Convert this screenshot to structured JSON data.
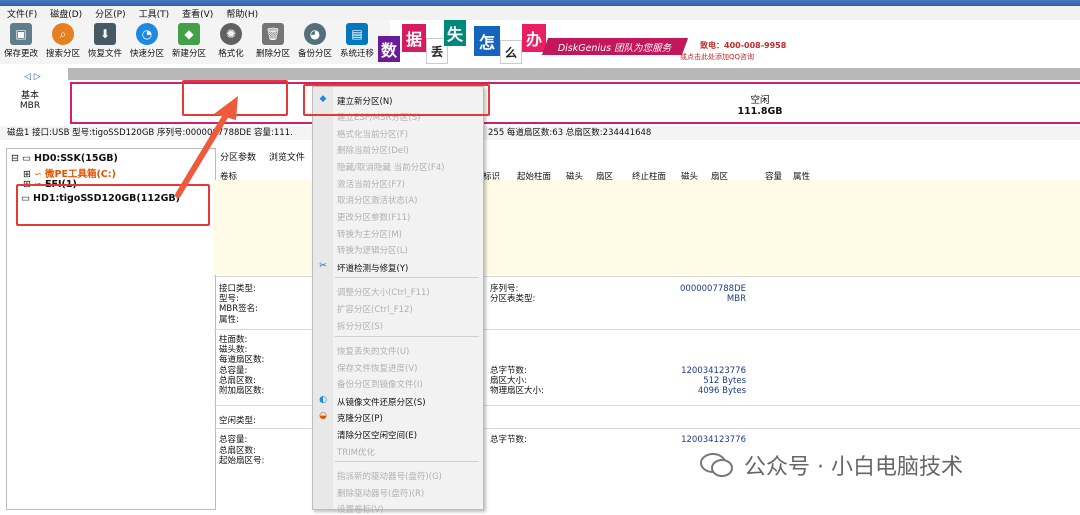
{
  "menu": [
    "文件(F)",
    "磁盘(D)",
    "分区(P)",
    "工具(T)",
    "查看(V)",
    "帮助(H)"
  ],
  "toolbar": [
    {
      "label": "保存更改",
      "icon": "save-icon",
      "color": "#607d8b"
    },
    {
      "label": "搜索分区",
      "icon": "search-icon",
      "color": "#e67e22"
    },
    {
      "label": "恢复文件",
      "icon": "restore-icon",
      "color": "#455a64"
    },
    {
      "label": "快速分区",
      "icon": "quick-partition-icon",
      "color": "#1e88e5"
    },
    {
      "label": "新建分区",
      "icon": "new-partition-icon",
      "color": "#43a047"
    },
    {
      "label": "格式化",
      "icon": "format-icon",
      "color": "#616161"
    },
    {
      "label": "删除分区",
      "icon": "delete-icon",
      "color": "#757575"
    },
    {
      "label": "备份分区",
      "icon": "backup-icon",
      "color": "#546e7a"
    },
    {
      "label": "系统迁移",
      "icon": "migrate-icon",
      "color": "#0277bd"
    }
  ],
  "banner": {
    "tiles": [
      "数",
      "据",
      "丢",
      "失",
      "怎",
      "么",
      "办"
    ],
    "tagline": "DiskGenius 团队为您服务",
    "phone": "致电：400-008-9958",
    "qq": "或点击此处添加QQ咨询"
  },
  "disk_label": {
    "line1": "基本",
    "line2": "MBR"
  },
  "free_space": {
    "label": "空闲",
    "size": "111.8GB"
  },
  "disk_info": "磁盘1 接口:USB 型号:tigoSSD120GB 序列号:0000007788DE 容量:111.",
  "disk_info_tail": "255 每道扇区数:63 总扇区数:234441648",
  "tree": {
    "hd0": "HD0:SSK(15GB)",
    "hd0_part": "微PE工具箱(C:)",
    "hd0_efi": "EFI(1)",
    "hd1": "HD1:tigoSSD120GB(112GB)"
  },
  "tabs": [
    "分区参数",
    "浏览文件"
  ],
  "columns": {
    "volume": "卷标",
    "id": "标识",
    "start_cyl": "起始柱面",
    "head1": "磁头",
    "sector1": "扇区",
    "end_cyl": "终止柱面",
    "head2": "磁头",
    "sector2": "扇区",
    "capacity": "容量",
    "attr": "属性"
  },
  "details": {
    "iface_label": "接口类型:",
    "model_label": "型号:",
    "mbr_sig_label": "MBR签名:",
    "attr_label": "属性:",
    "serial_label": "序列号:",
    "serial_value": "0000007788DE",
    "table_type_label": "分区表类型:",
    "table_type_value": "MBR",
    "cyl_label": "柱面数:",
    "heads_label": "磁头数:",
    "spt_label": "每道扇区数:",
    "cap_label": "总容量:",
    "total_sec_label": "总扇区数:",
    "extra_sec_label": "附加扇区数:",
    "total_bytes_label": "总字节数:",
    "total_bytes_value": "120034123776",
    "sector_size_label": "扇区大小:",
    "sector_size_value": "512 Bytes",
    "phys_sector_label": "物理扇区大小:",
    "phys_sector_value": "4096 Bytes",
    "free_type_label": "空闲类型:",
    "cap2_label": "总容量:",
    "total_sec2_label": "总扇区数:",
    "start_sec_label": "起始扇区号:",
    "total_bytes2_label": "总字节数:",
    "total_bytes2_value": "120034123776"
  },
  "context_menu": [
    {
      "label": "建立新分区(N)",
      "enabled": true,
      "icon": "new-partition-icon"
    },
    {
      "label": "建立ESP/MSR分区(S)",
      "enabled": false
    },
    {
      "label": "格式化当前分区(F)",
      "enabled": false
    },
    {
      "label": "删除当前分区(Del)",
      "enabled": false
    },
    {
      "label": "隐藏/取消隐藏 当前分区(F4)",
      "enabled": false
    },
    {
      "label": "激活当前分区(F7)",
      "enabled": false
    },
    {
      "label": "取消分区激活状态(A)",
      "enabled": false
    },
    {
      "label": "更改分区参数(F11)",
      "enabled": false
    },
    {
      "label": "转换为主分区(M)",
      "enabled": false
    },
    {
      "label": "转换为逻辑分区(L)",
      "enabled": false
    },
    {
      "label": "坏道检测与修复(Y)",
      "enabled": true,
      "icon": "repair-icon"
    },
    {
      "label": "调整分区大小(Ctrl_F11)",
      "enabled": false
    },
    {
      "label": "扩容分区(Ctrl_F12)",
      "enabled": false
    },
    {
      "label": "拆分分区(S)",
      "enabled": false
    },
    {
      "label": "恢复丢失的文件(U)",
      "enabled": false
    },
    {
      "label": "保存文件恢复进度(V)",
      "enabled": false
    },
    {
      "label": "备份分区到镜像文件(I)",
      "enabled": false
    },
    {
      "label": "从镜像文件还原分区(S)",
      "enabled": true,
      "icon": "restore-image-icon"
    },
    {
      "label": "克隆分区(P)",
      "enabled": true,
      "icon": "clone-icon"
    },
    {
      "label": "清除分区空闲空间(E)",
      "enabled": true
    },
    {
      "label": "TRIM优化",
      "enabled": false
    },
    {
      "label": "指派新的驱动器号(盘符)(G)",
      "enabled": false
    },
    {
      "label": "删除驱动器号(盘符)(R)",
      "enabled": false
    },
    {
      "label": "设置卷标(V)",
      "enabled": false
    }
  ],
  "watermark": "公众号 · 小白电脑技术",
  "colors": {
    "highlight": "#e53935",
    "partition_border": "#d21f6e",
    "accent": "#2e5fa8"
  }
}
